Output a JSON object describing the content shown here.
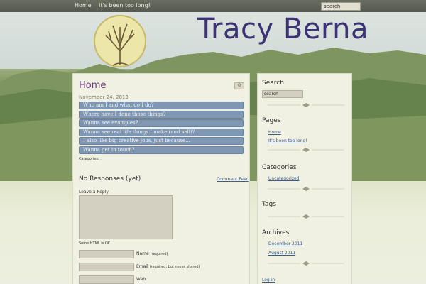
{
  "topnav": {
    "items": [
      {
        "label": "Home"
      },
      {
        "label": "It's been too long!"
      }
    ],
    "search_value": "search"
  },
  "header": {
    "site_title": "Tracy Berna",
    "logo_icon": "tree-sun-icon"
  },
  "post": {
    "title": "Home",
    "comment_count": "0",
    "date": "November 24, 2013",
    "links": [
      {
        "label": "Who am I and what do I do?"
      },
      {
        "label": "Where have I done those things?"
      },
      {
        "label": "Wanna see examples?"
      },
      {
        "label": "Wanna see real life things I make (and sell)?"
      },
      {
        "label": "I also like big creative jobs, just because..."
      },
      {
        "label": "Wanna get in touch?"
      }
    ],
    "categories_text": "Categories: ."
  },
  "comments": {
    "heading": "No Responses (yet)",
    "feed_link": "Comment Feed",
    "leave_reply": "Leave a Reply",
    "html_ok": "Some HTML is OK",
    "fields": [
      {
        "label": "Name",
        "note": "(required)"
      },
      {
        "label": "Email",
        "note": "(required, but never shared)"
      },
      {
        "label": "Web",
        "note": ""
      }
    ]
  },
  "sidebar": {
    "search_heading": "Search",
    "search_value": "search",
    "pages_heading": "Pages",
    "pages": [
      {
        "label": "Home"
      },
      {
        "label": "It's been too long!"
      }
    ],
    "categories_heading": "Categories",
    "categories": [
      {
        "label": "Uncategorized"
      }
    ],
    "tags_heading": "Tags",
    "archives_heading": "Archives",
    "archives": [
      {
        "label": "December 2011"
      },
      {
        "label": "August 2011"
      }
    ],
    "login_link": "Log in"
  },
  "colors": {
    "title_purple": "#3d3273",
    "post_title": "#6a3a7a",
    "link_bar": "#7f97b3",
    "link_text": "#3d5a8a"
  }
}
